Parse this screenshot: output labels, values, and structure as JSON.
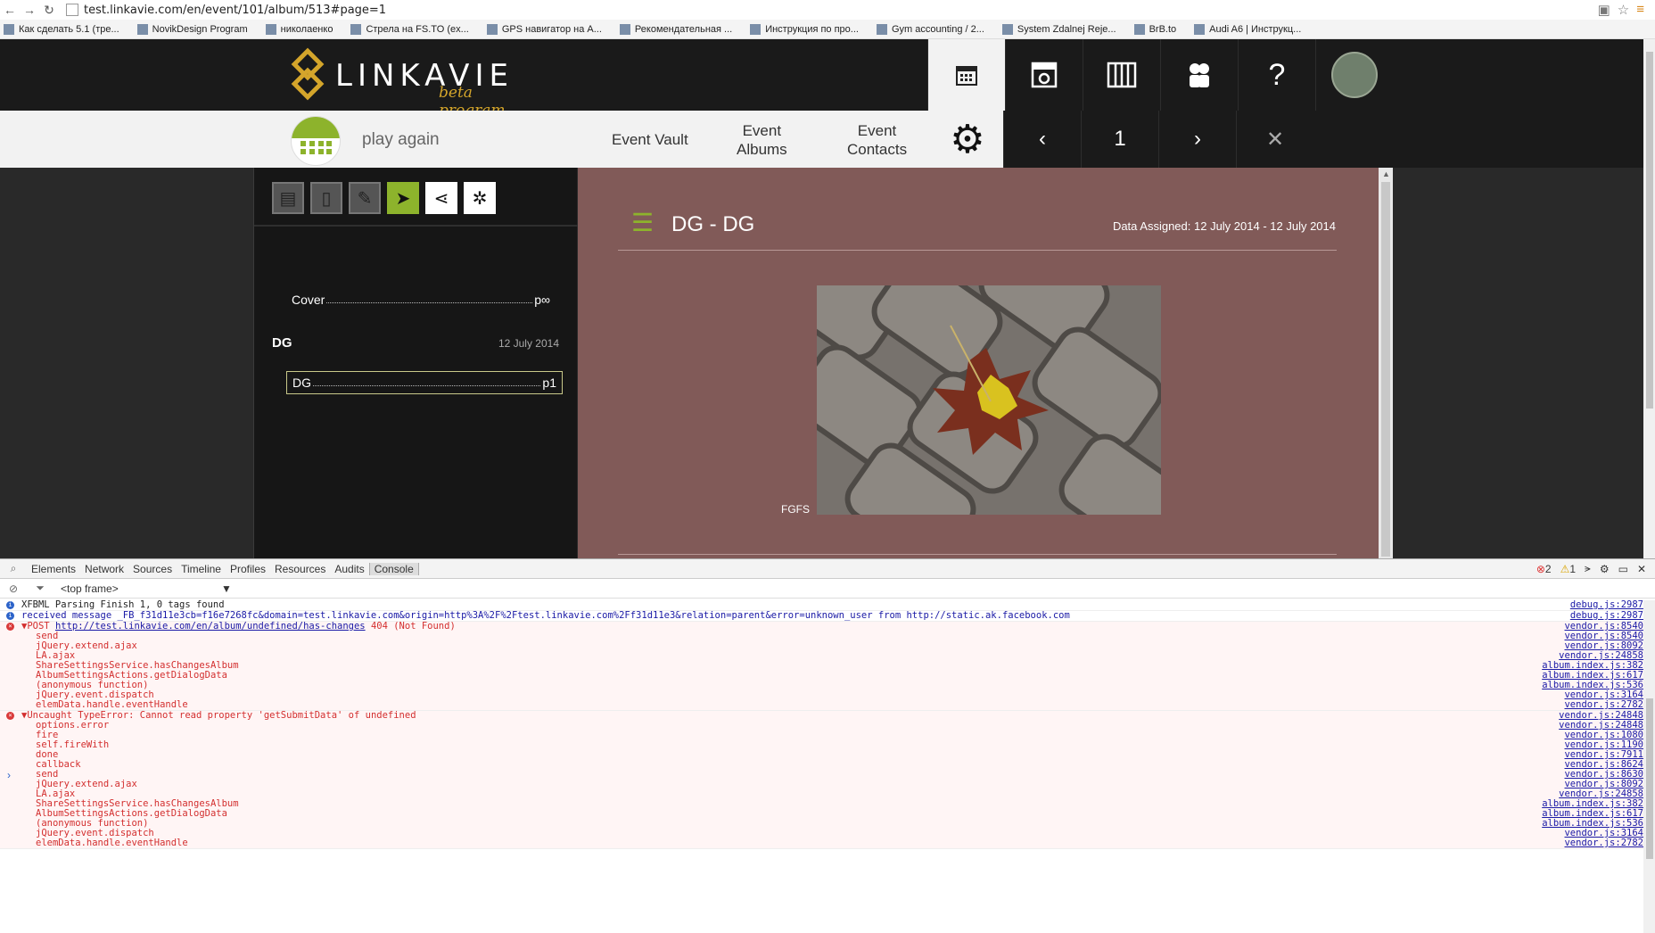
{
  "browser": {
    "url": "test.linkavie.com/en/event/101/album/513#page=1",
    "bookmarks": [
      "Как сделать 5.1 (тре...",
      "NovikDesign Program",
      "николаенко",
      "Стрела на FS.TO (ex...",
      "GPS навигатор на А...",
      "Рекомендательная ...",
      "Инструкция по про...",
      "Gym accounting / 2...",
      "System Zdalnej Reje...",
      "BrB.to",
      "Audi A6 | Инструкц..."
    ]
  },
  "app": {
    "logo_word": "LINKAVIE",
    "logo_beta": "beta program",
    "event_name": "play again",
    "nav": {
      "event_vault": "Event Vault",
      "event_albums_1": "Event",
      "event_albums_2": "Albums",
      "event_contacts_1": "Event",
      "event_contacts_2": "Contacts"
    },
    "help_label": "?",
    "pager": {
      "prev": "‹",
      "page": "1",
      "next": "›"
    }
  },
  "sidebar": {
    "cover_label": "Cover",
    "cover_page": "p∞",
    "section_title": "DG",
    "section_date": "12 July 2014",
    "entry_label": "DG",
    "entry_page": "p1"
  },
  "content": {
    "album_title": "DG - DG",
    "date_range": "Data Assigned: 12 July 2014 - 12 July 2014",
    "caption": "FGFS"
  },
  "devtools": {
    "tabs": [
      "Elements",
      "Network",
      "Sources",
      "Timeline",
      "Profiles",
      "Resources",
      "Audits",
      "Console"
    ],
    "error_count": "2",
    "warning_count": "1",
    "frame": "<top frame>",
    "messages": [
      {
        "level": "info",
        "text": "XFBML Parsing Finish 1, 0 tags found",
        "source": "debug.js:2987",
        "stack": []
      },
      {
        "level": "info",
        "text": "received message _FB_f31d11e3cb=f16e7268fc&domain=test.linkavie.com&origin=http%3A%2F%2Ftest.linkavie.com%2Ff31d11e3&relation=parent&error=unknown_user from http://static.ak.facebook.com",
        "source": "debug.js:2987",
        "stack": []
      },
      {
        "level": "error",
        "prefix": "POST ",
        "link": "http://test.linkavie.com/en/album/undefined/has-changes",
        "text": " 404 (Not Found)",
        "source": "vendor.js:8540",
        "stack": [
          [
            "send",
            "vendor.js:8540"
          ],
          [
            "jQuery.extend.ajax",
            "vendor.js:8092"
          ],
          [
            "LA.ajax",
            "vendor.js:24858"
          ],
          [
            "ShareSettingsService.hasChangesAlbum",
            "album.index.js:382"
          ],
          [
            "AlbumSettingsActions.getDialogData",
            "album.index.js:617"
          ],
          [
            "(anonymous function)",
            "album.index.js:536"
          ],
          [
            "jQuery.event.dispatch",
            "vendor.js:3164"
          ],
          [
            "elemData.handle.eventHandle",
            "vendor.js:2782"
          ]
        ]
      },
      {
        "level": "error",
        "prefix": "",
        "link": "",
        "text": "Uncaught TypeError: Cannot read property 'getSubmitData' of undefined",
        "source": "vendor.js:24848",
        "stack": [
          [
            "options.error",
            "vendor.js:24848"
          ],
          [
            "fire",
            "vendor.js:1080"
          ],
          [
            "self.fireWith",
            "vendor.js:1190"
          ],
          [
            "done",
            "vendor.js:7911"
          ],
          [
            "callback",
            "vendor.js:8624"
          ],
          [
            "send",
            "vendor.js:8630"
          ],
          [
            "jQuery.extend.ajax",
            "vendor.js:8092"
          ],
          [
            "LA.ajax",
            "vendor.js:24858"
          ],
          [
            "ShareSettingsService.hasChangesAlbum",
            "album.index.js:382"
          ],
          [
            "AlbumSettingsActions.getDialogData",
            "album.index.js:617"
          ],
          [
            "(anonymous function)",
            "album.index.js:536"
          ],
          [
            "jQuery.event.dispatch",
            "vendor.js:3164"
          ],
          [
            "elemData.handle.eventHandle",
            "vendor.js:2782"
          ]
        ]
      }
    ]
  },
  "colors": {
    "accent_green": "#8db32c",
    "logo_gold": "#d4a52b",
    "content_bg": "#815a58",
    "error_red": "#d32f2f"
  }
}
